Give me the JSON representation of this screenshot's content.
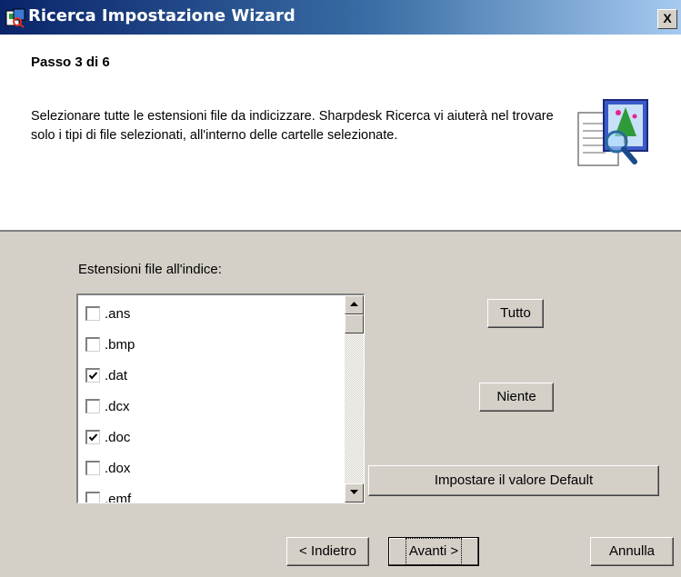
{
  "window": {
    "title": "Ricerca Impostazione Wizard",
    "close_symbol": "X",
    "icon": "wizard-app-icon"
  },
  "header": {
    "step": "Passo 3 di 6",
    "description": "Selezionare tutte le estensioni file da indicizzare. Sharpdesk Ricerca vi aiuterà nel trovare solo i tipi di file selezionati, all'interno delle cartelle selezionate.",
    "icon": "document-search-icon"
  },
  "extensions": {
    "label": "Estensioni file all'indice:",
    "items": [
      {
        "name": ".ans",
        "checked": false
      },
      {
        "name": ".bmp",
        "checked": false
      },
      {
        "name": ".dat",
        "checked": true
      },
      {
        "name": ".dcx",
        "checked": false
      },
      {
        "name": ".doc",
        "checked": true
      },
      {
        "name": ".dox",
        "checked": false
      },
      {
        "name": ".emf",
        "checked": false
      }
    ]
  },
  "buttons": {
    "all": "Tutto",
    "none": "Niente",
    "default": "Impostare il valore Default",
    "back": "< Indietro",
    "next": "Avanti >",
    "cancel": "Annulla"
  },
  "colors": {
    "titlebar_start": "#0a246a",
    "titlebar_end": "#a6caf0",
    "dialog_face": "#d4d0c8"
  }
}
